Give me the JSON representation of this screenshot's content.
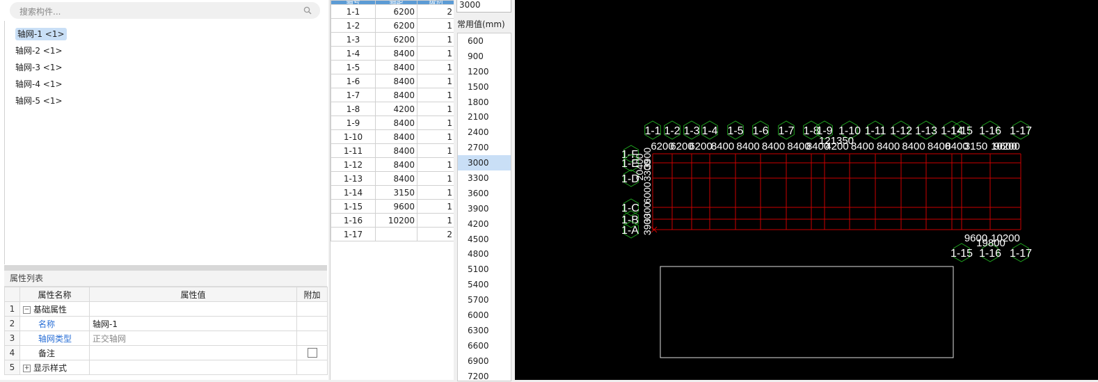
{
  "search": {
    "placeholder": "搜索构件..."
  },
  "tree_items": [
    "轴网-1 <1>",
    "轴网-2 <1>",
    "轴网-3 <1>",
    "轴网-4 <1>",
    "轴网-5 <1>"
  ],
  "properties": {
    "title": "属性列表",
    "headers": [
      "属性名称",
      "属性值",
      "附加"
    ],
    "rows": [
      {
        "idx": "1",
        "name": "基础属性",
        "value": ""
      },
      {
        "idx": "2",
        "name": "名称",
        "value": "轴网-1"
      },
      {
        "idx": "3",
        "name": "轴网类型",
        "value": "正交轴网"
      },
      {
        "idx": "4",
        "name": "备注",
        "value": ""
      },
      {
        "idx": "5",
        "name": "显示样式",
        "value": ""
      }
    ]
  },
  "axis_table": {
    "headers": [
      "轴号",
      "轴距",
      "级别"
    ],
    "rows": [
      [
        "1-1",
        "6200",
        "2"
      ],
      [
        "1-2",
        "6200",
        "1"
      ],
      [
        "1-3",
        "6200",
        "1"
      ],
      [
        "1-4",
        "8400",
        "1"
      ],
      [
        "1-5",
        "8400",
        "1"
      ],
      [
        "1-6",
        "8400",
        "1"
      ],
      [
        "1-7",
        "8400",
        "1"
      ],
      [
        "1-8",
        "4200",
        "1"
      ],
      [
        "1-9",
        "8400",
        "1"
      ],
      [
        "1-10",
        "8400",
        "1"
      ],
      [
        "1-11",
        "8400",
        "1"
      ],
      [
        "1-12",
        "8400",
        "1"
      ],
      [
        "1-13",
        "8400",
        "1"
      ],
      [
        "1-14",
        "3150",
        "1"
      ],
      [
        "1-15",
        "9600",
        "1"
      ],
      [
        "1-16",
        "10200",
        "1"
      ],
      [
        "1-17",
        "",
        "2"
      ]
    ]
  },
  "value_panel": {
    "current": "3000",
    "common_label": "常用值(mm)",
    "values": [
      "600",
      "900",
      "1200",
      "1500",
      "1800",
      "2100",
      "2400",
      "2700",
      "3000",
      "3300",
      "3600",
      "3900",
      "4200",
      "4500",
      "4800",
      "5100",
      "5400",
      "5700",
      "6000",
      "6300",
      "6600",
      "6900",
      "7200"
    ],
    "selected_value": "3000"
  },
  "canvas": {
    "top_axis_labels": [
      "1-1",
      "1-2",
      "1-3",
      "1-4",
      "1-5",
      "1-6",
      "1-7",
      "1-8",
      "1-9",
      "1-10",
      "1-11",
      "1-12",
      "1-13",
      "1-14",
      "1-15",
      "1-16",
      "1-17"
    ],
    "top_spacings": [
      "6200",
      "6200",
      "6200",
      "8400",
      "8400",
      "8400",
      "8400",
      "8400",
      "4200",
      "8400",
      "8400",
      "8400",
      "8400",
      "8400",
      "3150",
      "9600",
      "10200"
    ],
    "top_total": "121350",
    "bottom_axis_labels": [
      "1-15",
      "1-16",
      "1-17"
    ],
    "bottom_spacings": [
      "9600",
      "10200"
    ],
    "bottom_total": "19800",
    "left_axis_labels": [
      "1-F",
      "1-E",
      "1-D",
      "1-C",
      "1-B",
      "1-A"
    ],
    "left_spacings": [
      "3900",
      "3300",
      "6000",
      "3300",
      "3900"
    ],
    "left_total": "20400",
    "colors": {
      "grid": "#cc0000",
      "bubble": "#1fa31f",
      "text": "#ffffff",
      "background": "#000000"
    }
  }
}
